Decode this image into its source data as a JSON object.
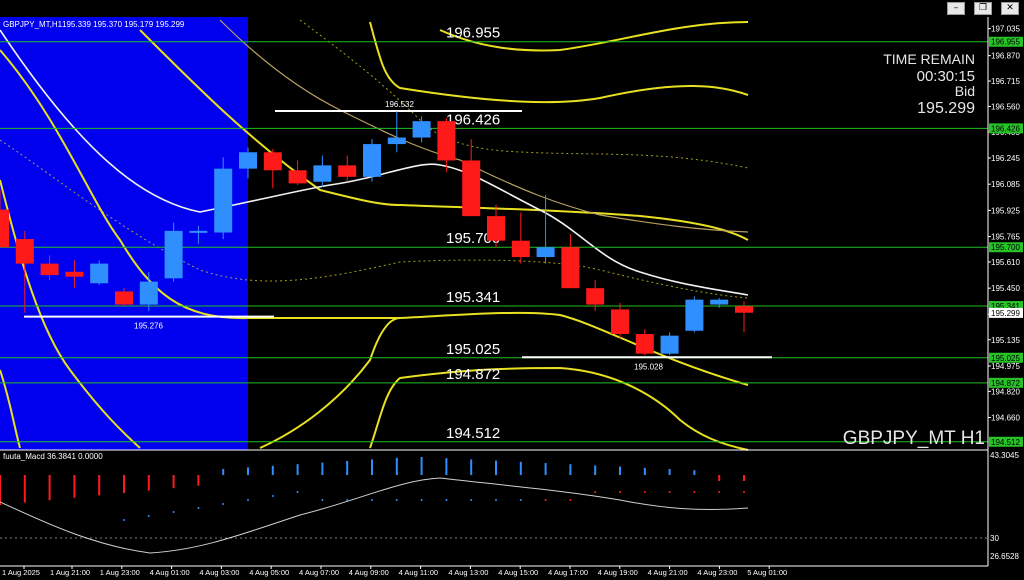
{
  "window": {
    "title": "GBPJPY_MT,H1",
    "ohlc": "195.339 195.370 195.179 195.299",
    "buttons": [
      "minimize",
      "restore",
      "close"
    ]
  },
  "overlay": {
    "time_remain_label": "TIME REMAIN",
    "time_remain": "00:30:15",
    "bid_label": "Bid",
    "bid": "195.299",
    "symbol_watermark": "GBPJPY_MT H1"
  },
  "colors": {
    "background": "#000000",
    "blue_zone": "#0000ee",
    "bull_candle": "#2f8fff",
    "bear_candle": "#ff1a1a",
    "level_line": "#1fbf1f",
    "band_yellow": "#e8e020",
    "ma_white": "#f2f2f2",
    "price_tag": "#27c227"
  },
  "levels": [
    {
      "price": 196.955,
      "label": "196.955"
    },
    {
      "price": 196.426,
      "label": "196.426"
    },
    {
      "price": 195.7,
      "label": "195.700"
    },
    {
      "price": 195.341,
      "label": "195.341"
    },
    {
      "price": 195.025,
      "label": "195.025"
    },
    {
      "price": 194.872,
      "label": "194.872"
    },
    {
      "price": 194.512,
      "label": "194.512"
    }
  ],
  "swing_labels": [
    {
      "label": "196.532",
      "price": 196.532
    },
    {
      "label": "195.276",
      "price": 195.276
    },
    {
      "label": "195.028",
      "price": 195.028
    }
  ],
  "price_axis_ticks": [
    "197.035",
    "196.870",
    "196.715",
    "196.560",
    "196.405",
    "196.245",
    "196.085",
    "195.925",
    "195.765",
    "195.610",
    "195.450",
    "195.290",
    "195.135",
    "194.975",
    "194.820",
    "194.660"
  ],
  "price_axis_tags": [
    "196.955",
    "196.426",
    "195.700",
    "195.341",
    "195.299",
    "195.025",
    "194.872",
    "194.512"
  ],
  "time_axis_labels": [
    "1 Aug 2025",
    "1 Aug 21:00",
    "1 Aug 23:00",
    "4 Aug 01:00",
    "4 Aug 03:00",
    "4 Aug 05:00",
    "4 Aug 07:00",
    "4 Aug 09:00",
    "4 Aug 11:00",
    "4 Aug 13:00",
    "4 Aug 15:00",
    "4 Aug 17:00",
    "4 Aug 19:00",
    "4 Aug 21:00",
    "4 Aug 23:00",
    "5 Aug 01:00"
  ],
  "macd": {
    "header": "fuuta_Macd 36.3841  0.0000",
    "scale_top": "43.3045",
    "scale_mid": "30",
    "scale_bottom": "26.6528"
  },
  "chart_data": {
    "type": "candlestick",
    "symbol": "GBPJPY_MT",
    "timeframe": "H1",
    "candles": [
      {
        "o": 195.93,
        "h": 196.05,
        "l": 195.7,
        "c": 195.7
      },
      {
        "o": 195.75,
        "h": 195.8,
        "l": 195.3,
        "c": 195.6
      },
      {
        "o": 195.6,
        "h": 195.65,
        "l": 195.5,
        "c": 195.53
      },
      {
        "o": 195.55,
        "h": 195.62,
        "l": 195.45,
        "c": 195.52
      },
      {
        "o": 195.48,
        "h": 195.62,
        "l": 195.47,
        "c": 195.6
      },
      {
        "o": 195.43,
        "h": 195.45,
        "l": 195.34,
        "c": 195.35
      },
      {
        "o": 195.35,
        "h": 195.55,
        "l": 195.31,
        "c": 195.49
      },
      {
        "o": 195.51,
        "h": 195.85,
        "l": 195.49,
        "c": 195.8
      },
      {
        "o": 195.79,
        "h": 195.83,
        "l": 195.72,
        "c": 195.8
      },
      {
        "o": 195.79,
        "h": 196.25,
        "l": 195.75,
        "c": 196.18
      },
      {
        "o": 196.18,
        "h": 196.31,
        "l": 196.12,
        "c": 196.28
      },
      {
        "o": 196.28,
        "h": 196.3,
        "l": 196.06,
        "c": 196.17
      },
      {
        "o": 196.17,
        "h": 196.23,
        "l": 196.08,
        "c": 196.09
      },
      {
        "o": 196.1,
        "h": 196.26,
        "l": 196.07,
        "c": 196.2
      },
      {
        "o": 196.2,
        "h": 196.26,
        "l": 196.1,
        "c": 196.13
      },
      {
        "o": 196.13,
        "h": 196.36,
        "l": 196.1,
        "c": 196.33
      },
      {
        "o": 196.33,
        "h": 196.53,
        "l": 196.28,
        "c": 196.37
      },
      {
        "o": 196.37,
        "h": 196.5,
        "l": 196.34,
        "c": 196.47
      },
      {
        "o": 196.47,
        "h": 196.49,
        "l": 196.16,
        "c": 196.23
      },
      {
        "o": 196.23,
        "h": 196.36,
        "l": 195.89,
        "c": 195.89
      },
      {
        "o": 195.89,
        "h": 195.96,
        "l": 195.7,
        "c": 195.74
      },
      {
        "o": 195.74,
        "h": 195.91,
        "l": 195.6,
        "c": 195.64
      },
      {
        "o": 195.64,
        "h": 196.02,
        "l": 195.6,
        "c": 195.7
      },
      {
        "o": 195.7,
        "h": 195.78,
        "l": 195.45,
        "c": 195.45
      },
      {
        "o": 195.45,
        "h": 195.5,
        "l": 195.31,
        "c": 195.35
      },
      {
        "o": 195.32,
        "h": 195.36,
        "l": 195.14,
        "c": 195.17
      },
      {
        "o": 195.17,
        "h": 195.2,
        "l": 195.04,
        "c": 195.05
      },
      {
        "o": 195.05,
        "h": 195.18,
        "l": 195.04,
        "c": 195.16
      },
      {
        "o": 195.19,
        "h": 195.4,
        "l": 195.18,
        "c": 195.38
      },
      {
        "o": 195.35,
        "h": 195.39,
        "l": 195.33,
        "c": 195.38
      },
      {
        "o": 195.34,
        "h": 195.37,
        "l": 195.18,
        "c": 195.3
      }
    ],
    "y_range": [
      194.48,
      197.1
    ],
    "grid": false
  }
}
